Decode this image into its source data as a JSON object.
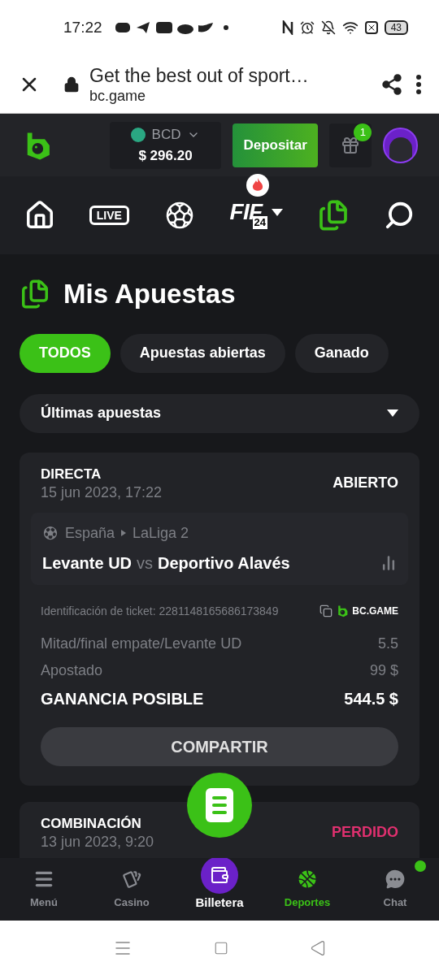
{
  "status_bar": {
    "time": "17:22",
    "battery": "43"
  },
  "browser": {
    "title": "Get the best out of sport…",
    "url": "bc.game"
  },
  "header": {
    "currency": "BCD",
    "balance": "$ 296.20",
    "deposit": "Depositar",
    "gift_badge": "1"
  },
  "nav": [
    {
      "kind": "home",
      "selected": false
    },
    {
      "kind": "live",
      "label": "LIVE",
      "selected": false
    },
    {
      "kind": "soccer",
      "selected": false
    },
    {
      "kind": "fifa",
      "label": "FIF",
      "sub": "24",
      "selected": false
    },
    {
      "kind": "bets",
      "selected": true
    },
    {
      "kind": "search",
      "selected": false
    }
  ],
  "page": {
    "title": "Mis Apuestas"
  },
  "tabs": [
    {
      "label": "TODOS",
      "selected": true
    },
    {
      "label": "Apuestas abiertas",
      "selected": false
    },
    {
      "label": "Ganado",
      "selected": false
    }
  ],
  "filter": {
    "value": "Últimas apuestas"
  },
  "bets": [
    {
      "type": "DIRECTA",
      "date": "15 jun 2023, 17:22",
      "result": {
        "text": "ABIERTO",
        "kind": "open"
      },
      "league": {
        "country": "España",
        "name": "LaLiga 2"
      },
      "match": {
        "home": "Levante UD",
        "vs": "vs",
        "away": "Deportivo Alavés"
      },
      "ticket": "Identificación de ticket: 2281148165686173849",
      "brand": "BC.GAME",
      "rows": [
        {
          "label": "Mitad/final empate/Levante UD",
          "value": "5.5",
          "kind": "muted"
        },
        {
          "label": "Apostado",
          "value": "99 $",
          "kind": "muted"
        },
        {
          "label": "GANANCIA POSIBLE",
          "value": "544.5 $",
          "kind": "strong"
        }
      ],
      "share": "COMPARTIR"
    },
    {
      "type": "COMBINACIÓN",
      "date": "13 jun 2023, 9:20",
      "result": {
        "text": "PERDIDO",
        "kind": "lost"
      }
    }
  ],
  "bottom_nav": [
    {
      "kind": "menu",
      "label": "Menú",
      "selected": false
    },
    {
      "kind": "casino",
      "label": "Casino",
      "selected": false
    },
    {
      "kind": "wallet",
      "label": "Billetera",
      "selected": false
    },
    {
      "kind": "sports",
      "label": "Deportes",
      "selected": true
    },
    {
      "kind": "chat",
      "label": "Chat",
      "selected": false,
      "dot": true
    }
  ]
}
